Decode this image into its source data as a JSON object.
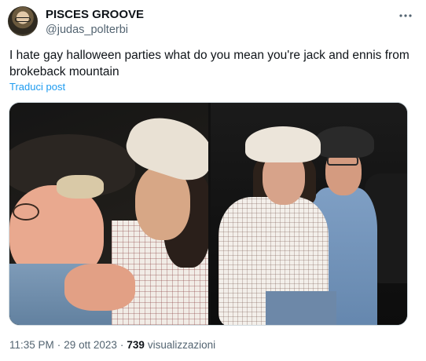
{
  "author": {
    "display_name": "PISCES GROOVE",
    "handle": "@judas_polterbi"
  },
  "tweet": {
    "text": "I hate gay halloween parties what do you mean you're jack and ennis from brokeback mountain",
    "translate_label": "Traduci post"
  },
  "meta": {
    "time": "11:35 PM",
    "separator": "·",
    "date": "29 ott 2023",
    "views_count": "739",
    "views_label": "visualizzazioni"
  },
  "icons": {
    "avatar": "user-avatar",
    "more": "more-options-icon"
  },
  "colors": {
    "link": "#1d9bf0",
    "secondary_text": "#536471",
    "primary_text": "#0f1419"
  }
}
